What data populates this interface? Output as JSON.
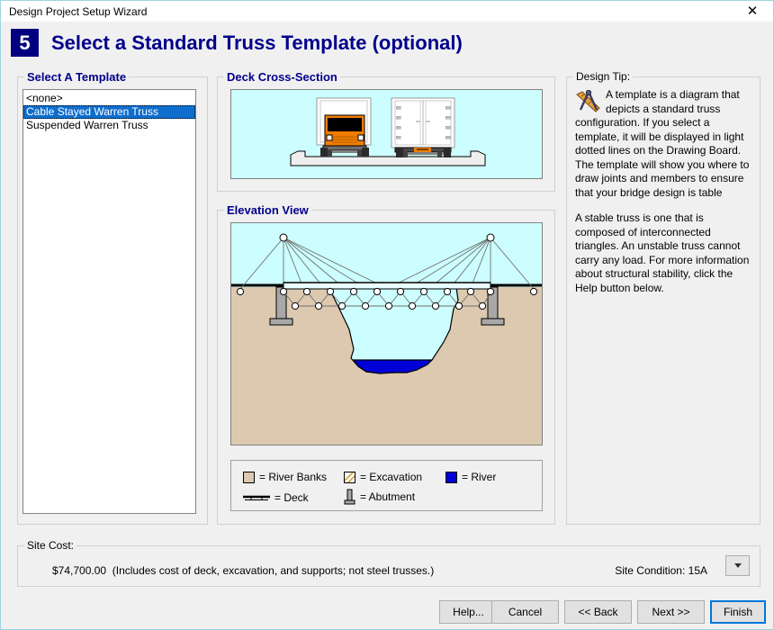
{
  "window": {
    "title": "Design Project Setup Wizard",
    "close_icon": "close-icon"
  },
  "header": {
    "step_number": "5",
    "title": "Select a Standard Truss Template (optional)"
  },
  "template_panel": {
    "legend": "Select A Template",
    "items": [
      {
        "label": "<none>",
        "selected": false
      },
      {
        "label": "Cable Stayed Warren Truss",
        "selected": true
      },
      {
        "label": "Suspended Warren Truss",
        "selected": false
      }
    ]
  },
  "deck_panel": {
    "legend": "Deck Cross-Section"
  },
  "elevation_panel": {
    "legend": "Elevation View",
    "legend_items": [
      {
        "icon": "river-banks-swatch",
        "label": "= River Banks"
      },
      {
        "icon": "excavation-swatch",
        "label": "= Excavation"
      },
      {
        "icon": "river-swatch",
        "label": "= River"
      },
      {
        "icon": "deck-swatch",
        "label": "= Deck"
      },
      {
        "icon": "abutment-swatch",
        "label": "= Abutment"
      }
    ]
  },
  "design_tip": {
    "legend": "Design Tip:",
    "icon": "drafting-compass-icon",
    "paragraphs": [
      "A template is a diagram that depicts a standard truss configuration. If you select a template, it will be displayed in light dotted lines on the Drawing Board. The template will show you where to draw joints and members to ensure that your bridge design is table",
      "A stable truss is one that is composed of interconnected triangles. An unstable truss cannot carry any load. For more information about structural stability, click the Help button below."
    ]
  },
  "site_cost": {
    "legend": "Site Cost:",
    "amount": "$74,700.00",
    "note": "(Includes cost of deck, excavation, and supports; not steel trusses.)",
    "site_condition_label": "Site Condition: 15A",
    "dropdown_icon": "chevron-down-icon"
  },
  "buttons": {
    "help": "Help...",
    "cancel": "Cancel",
    "back": "<< Back",
    "next": "Next >>",
    "finish": "Finish"
  },
  "colors": {
    "accent_navy": "#00008b",
    "badge": "#000080",
    "selection": "#0f6ecd",
    "sky": "#ccfeff",
    "river_bank": "#dcc9b0",
    "river": "#0000d8",
    "focus": "#0078d7"
  }
}
